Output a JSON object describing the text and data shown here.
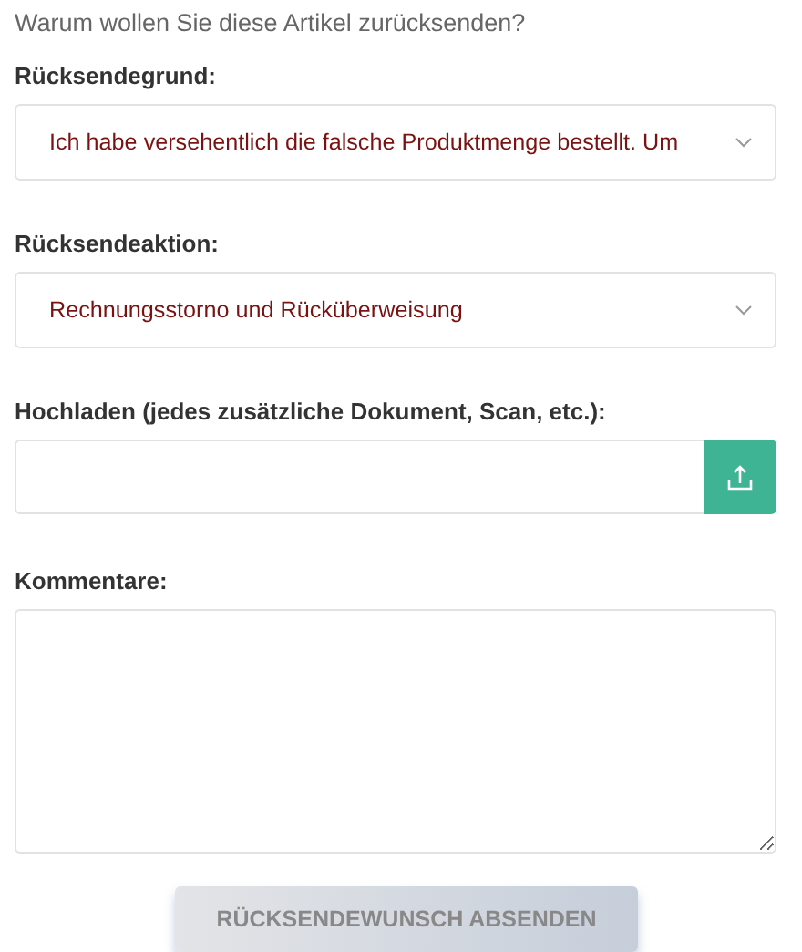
{
  "question": "Warum wollen Sie diese Artikel zurücksenden?",
  "reason": {
    "label": "Rücksendegrund:",
    "value": "Ich habe versehentlich die falsche Produktmenge bestellt. Um"
  },
  "action": {
    "label": "Rücksendeaktion:",
    "value": "Rechnungsstorno und Rücküberweisung"
  },
  "upload": {
    "label": "Hochladen (jedes zusätzliche Dokument, Scan, etc.):"
  },
  "comments": {
    "label": "Kommentare:"
  },
  "submit": {
    "label": "RÜCKSENDEWUNSCH ABSENDEN",
    "disabled": true
  }
}
